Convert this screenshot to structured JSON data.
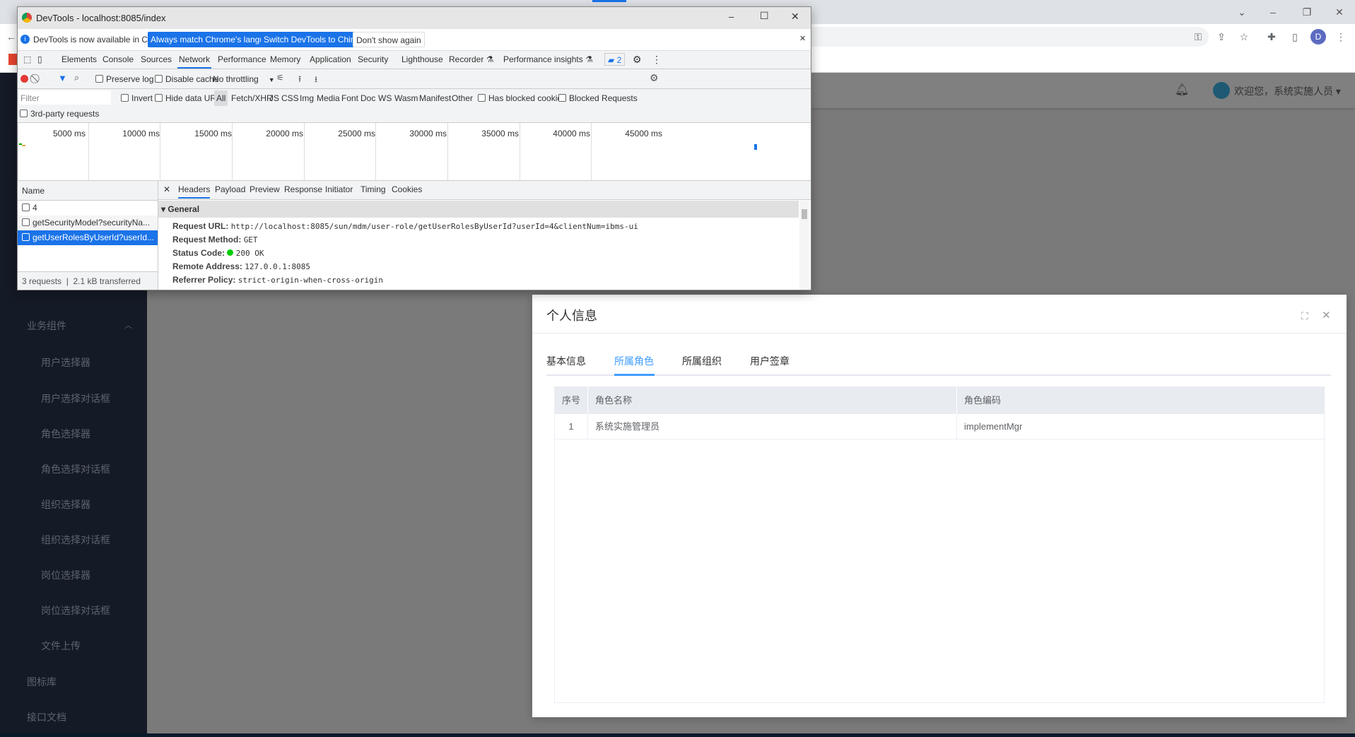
{
  "browser": {
    "profile_initial": "D"
  },
  "app_header": {
    "user_greeting": "欢迎您，系统实施人员"
  },
  "sidebar": {
    "group": "业务组件",
    "items": [
      "用户选择器",
      "用户选择对话框",
      "角色选择器",
      "角色选择对话框",
      "组织选择器",
      "组织选择对话框",
      "岗位选择器",
      "岗位选择对话框",
      "文件上传"
    ],
    "bottom_items": [
      "图标库",
      "接口文档"
    ]
  },
  "modal": {
    "title": "个人信息",
    "tabs": [
      "基本信息",
      "所属角色",
      "所属组织",
      "用户签章"
    ],
    "active_tab": "所属角色",
    "table": {
      "headers": [
        "序号",
        "角色名称",
        "角色编码"
      ],
      "rows": [
        [
          "1",
          "系统实施管理员",
          "implementMgr"
        ]
      ]
    }
  },
  "devtools": {
    "title": "DevTools - localhost:8085/index",
    "infobar": {
      "text": "DevTools is now available in Chinese!",
      "btn_match": "Always match Chrome's language",
      "btn_switch": "Switch DevTools to Chinese",
      "btn_dismiss": "Don't show again"
    },
    "tabs": [
      "Elements",
      "Console",
      "Sources",
      "Network",
      "Performance",
      "Memory",
      "Application",
      "Security",
      "Lighthouse",
      "Recorder",
      "Performance insights"
    ],
    "active_tab": "Network",
    "issues_count": "2",
    "toolbar": {
      "preserve_log": "Preserve log",
      "disable_cache": "Disable cache",
      "throttling": "No throttling"
    },
    "filter": {
      "placeholder": "Filter",
      "invert": "Invert",
      "hide_data_urls": "Hide data URLs",
      "types": [
        "All",
        "Fetch/XHR",
        "JS",
        "CSS",
        "Img",
        "Media",
        "Font",
        "Doc",
        "WS",
        "Wasm",
        "Manifest",
        "Other"
      ],
      "has_blocked_cookies": "Has blocked cookies",
      "blocked_requests": "Blocked Requests",
      "third_party": "3rd-party requests"
    },
    "timeline": [
      "5000 ms",
      "10000 ms",
      "15000 ms",
      "20000 ms",
      "25000 ms",
      "30000 ms",
      "35000 ms",
      "40000 ms",
      "45000 ms"
    ],
    "requests": {
      "header": "Name",
      "items": [
        "4",
        "getSecurityModel?securityNa...",
        "getUserRolesByUserId?userId..."
      ],
      "selected": 2,
      "summary_count": "3 requests",
      "summary_size": "2.1 kB transferred"
    },
    "detail": {
      "tabs": [
        "Headers",
        "Payload",
        "Preview",
        "Response",
        "Initiator",
        "Timing",
        "Cookies"
      ],
      "active": "Headers",
      "section": "General",
      "rows": [
        {
          "k": "Request URL:",
          "v": "http://localhost:8085/sun/mdm/user-role/getUserRolesByUserId?userId=4&clientNum=ibms-ui"
        },
        {
          "k": "Request Method:",
          "v": "GET"
        },
        {
          "k": "Status Code:",
          "v": "200 OK"
        },
        {
          "k": "Remote Address:",
          "v": "127.0.0.1:8085"
        },
        {
          "k": "Referrer Policy:",
          "v": "strict-origin-when-cross-origin"
        }
      ]
    }
  }
}
